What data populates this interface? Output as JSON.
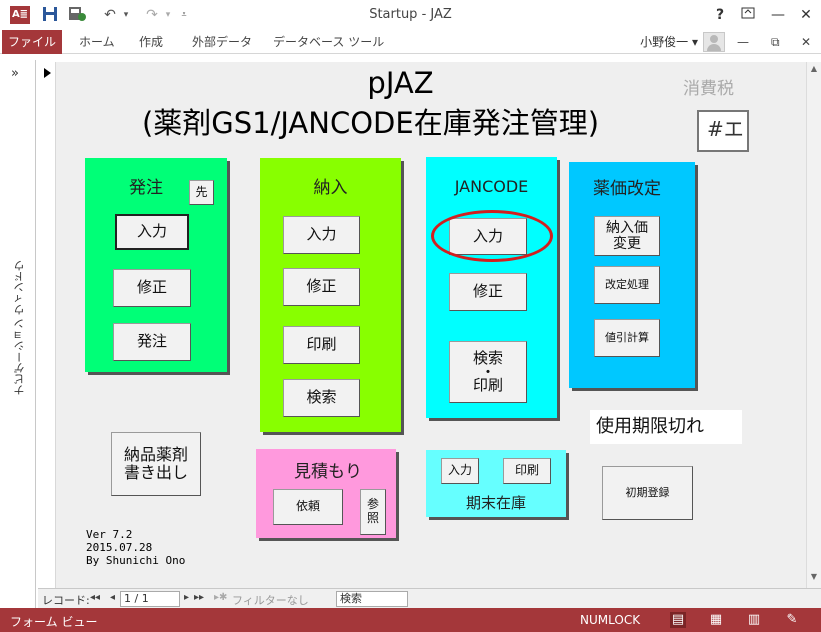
{
  "window": {
    "title": "Startup - JAZ",
    "help": "?",
    "minimize": "—",
    "maximize": "☐",
    "close": "✕",
    "app_icon_text": "A≣"
  },
  "quick_access": {
    "save_icon": "save-icon",
    "undo_icon": "undo-icon",
    "redo_icon": "redo-icon",
    "customize_icon": "customize-icon"
  },
  "ribbon": {
    "file": "ファイル",
    "tabs": [
      "ホーム",
      "作成",
      "外部データ",
      "データベース ツール"
    ],
    "user": "小野俊一 ▾",
    "ribbon_min": "—",
    "ribbon_restore": "⧉",
    "ribbon_close": "✕"
  },
  "navpane": {
    "chevron": "»",
    "label": "ナビゲーション ウィンドウ"
  },
  "form": {
    "title_line1": "pJAZ",
    "title_line2": "(薬剤GS1/JANCODE在庫発注管理)",
    "tax_label": "消費税",
    "tax_field": "#エ",
    "order": {
      "title": "発注",
      "advance": "先",
      "input": "入力",
      "edit": "修正",
      "order": "発注"
    },
    "delivery": {
      "title": "納入",
      "input": "入力",
      "edit": "修正",
      "print": "印刷",
      "search": "検索"
    },
    "jancode": {
      "title": "JANCODE",
      "input": "入力",
      "edit": "修正",
      "search_print_1": "検索",
      "search_print_2": "・",
      "search_print_3": "印刷"
    },
    "price_revision": {
      "title": "薬価改定",
      "delivery_price_1": "納入価",
      "delivery_price_2": "変更",
      "revision_process": "改定処理",
      "discount_calc": "値引計算"
    },
    "export": {
      "line1": "納品薬剤",
      "line2": "書き出し"
    },
    "estimate": {
      "title": "見積もり",
      "request": "依頼",
      "ref_1": "参",
      "ref_2": "照"
    },
    "period_end": {
      "title": "期末在庫",
      "input": "入力",
      "print": "印刷"
    },
    "expiry": "使用期限切れ",
    "initial_register": "初期登録",
    "version_lines": [
      "Ver 7.2",
      "2015.07.28",
      "By Shunichi Ono"
    ]
  },
  "record_nav": {
    "label": "レコード:",
    "first": "◂◂",
    "prev": "◂",
    "current": "1 / 1",
    "next": "▸",
    "last": "▸▸",
    "new": "▸✱",
    "filter": "フィルターなし",
    "search": "検索"
  },
  "status": {
    "view": "フォーム ビュー",
    "numlock": "NUMLOCK"
  },
  "colors": {
    "access_red": "#a4373a",
    "order_panel": "#00ff77",
    "delivery_panel": "#88ff00",
    "jancode_panel": "#00ffff",
    "price_panel": "#00c8ff",
    "estimate_panel": "#ff99dd",
    "period_panel": "#66ffff",
    "highlight": "#d21f1f"
  }
}
